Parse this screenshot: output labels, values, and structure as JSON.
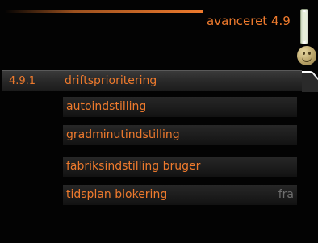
{
  "header": {
    "title": "avanceret 4.9",
    "thermometer_icon": "thermometer-icon",
    "status_icon": "smiley-icon",
    "accent_color": "#ee7a2d"
  },
  "menu": {
    "items": [
      {
        "number": "4.9.1",
        "label": "driftsprioritering",
        "value": "",
        "selected": true
      },
      {
        "number": "",
        "label": "autoindstilling",
        "value": ""
      },
      {
        "number": "",
        "label": "gradminutindstilling",
        "value": ""
      },
      {
        "number": "",
        "label": "fabriksindstilling bruger",
        "value": ""
      },
      {
        "number": "",
        "label": "tidsplan blokering",
        "value": "fra"
      }
    ]
  }
}
